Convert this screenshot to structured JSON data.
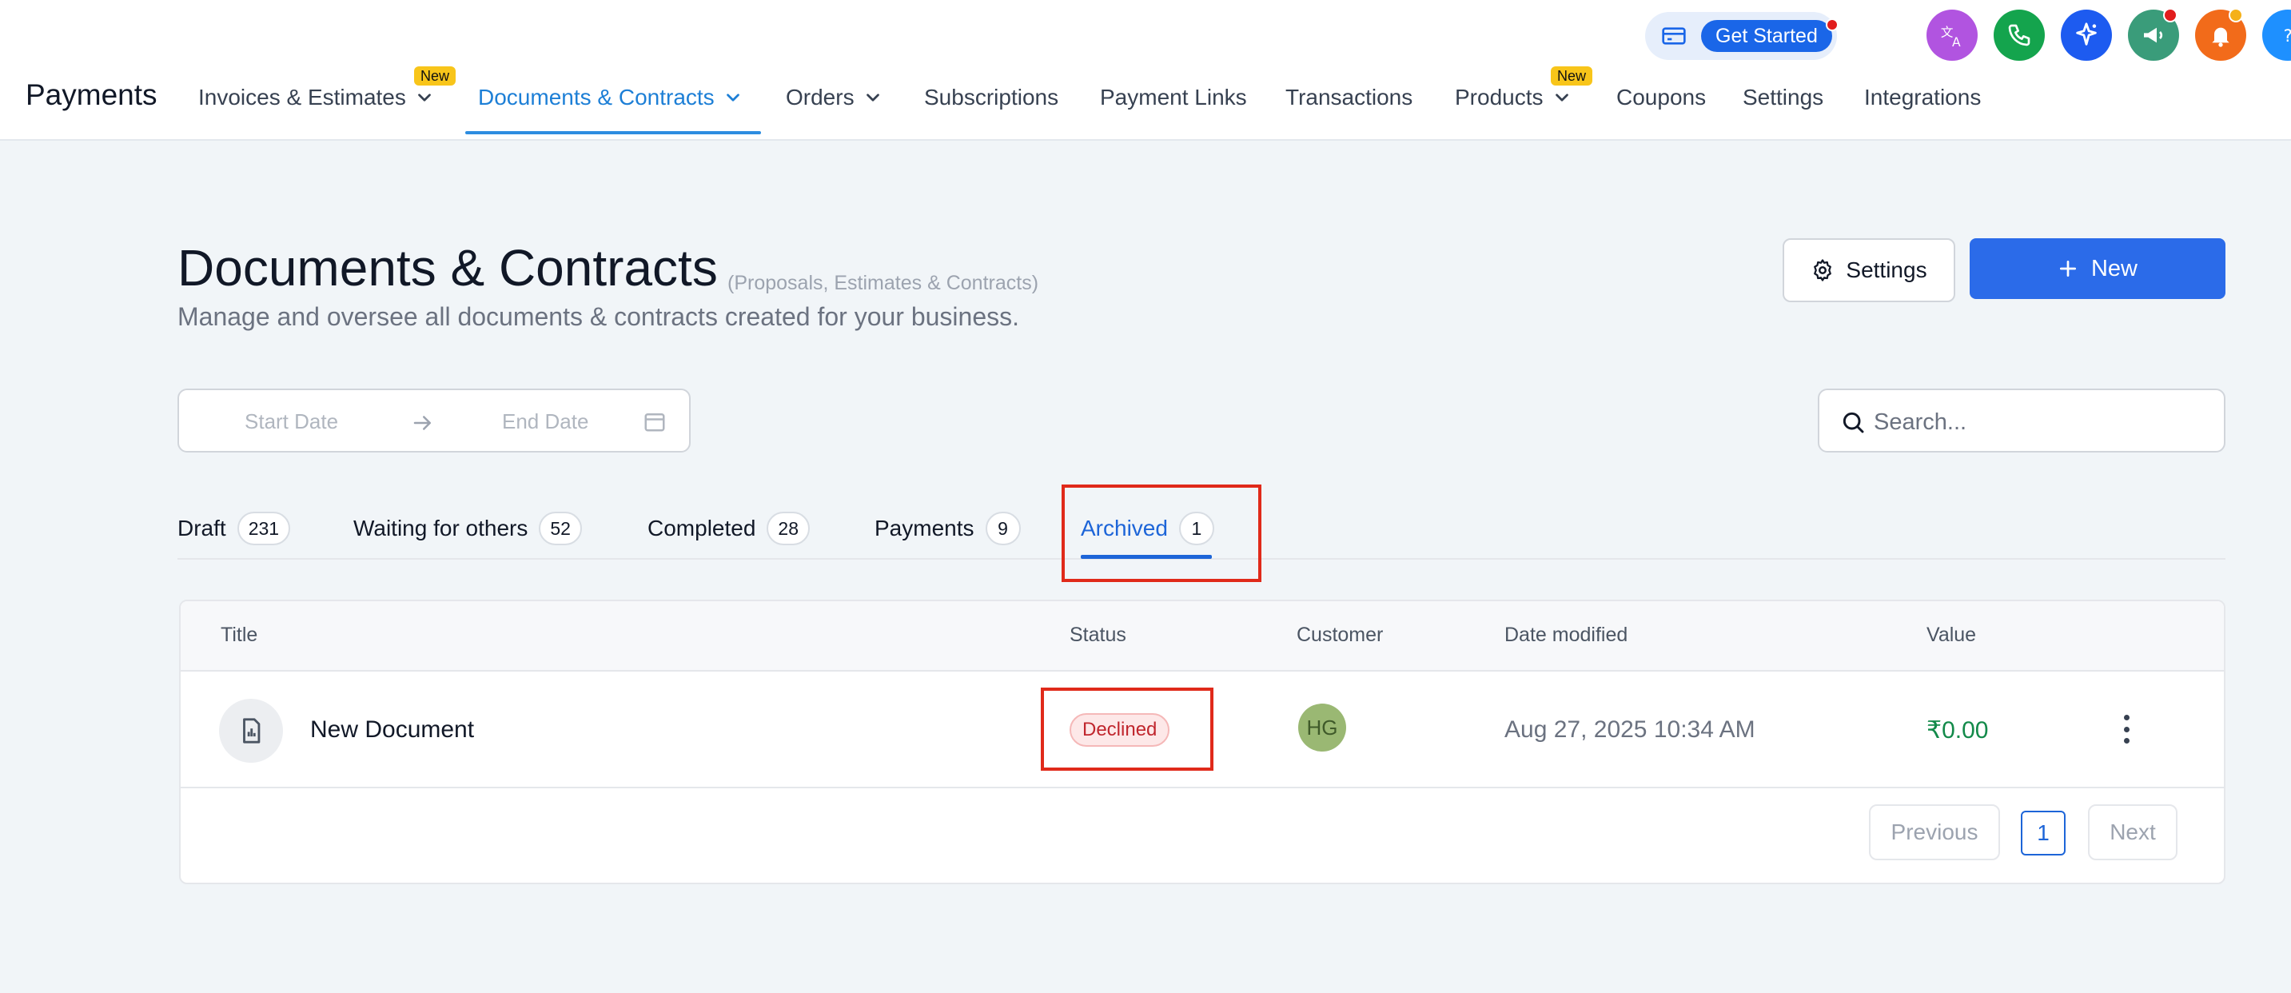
{
  "header": {
    "brand": "Payments",
    "nav": [
      {
        "label": "Invoices & Estimates",
        "badge": "New"
      },
      {
        "label": "Documents & Contracts"
      },
      {
        "label": "Orders"
      },
      {
        "label": "Subscriptions"
      },
      {
        "label": "Payment Links"
      },
      {
        "label": "Transactions"
      },
      {
        "label": "Products",
        "badge": "New"
      },
      {
        "label": "Coupons"
      },
      {
        "label": "Settings"
      },
      {
        "label": "Integrations"
      }
    ],
    "get_started": "Get Started",
    "icons": [
      "translate-icon",
      "phone-icon",
      "ai-sparkle-icon",
      "megaphone-icon",
      "bell-icon",
      "help-icon"
    ],
    "colors": {
      "translate": "#b154e0",
      "phone": "#14a44d",
      "ai": "#1d5bf0",
      "megaphone": "#3a9c7a",
      "bell": "#f26b1a",
      "help": "#1e90ff"
    }
  },
  "page": {
    "title": "Documents & Contracts",
    "subtitle": "(Proposals, Estimates & Contracts)",
    "description": "Manage and oversee all documents & contracts created for your business.",
    "settings_label": "Settings",
    "new_label": "New"
  },
  "filters": {
    "start_date": "Start Date",
    "end_date": "End Date",
    "search_placeholder": "Search..."
  },
  "tabs": [
    {
      "label": "Draft",
      "count": "231"
    },
    {
      "label": "Waiting for others",
      "count": "52"
    },
    {
      "label": "Completed",
      "count": "28"
    },
    {
      "label": "Payments",
      "count": "9"
    },
    {
      "label": "Archived",
      "count": "1",
      "active": true
    }
  ],
  "table": {
    "columns": [
      "Title",
      "Status",
      "Customer",
      "Date modified",
      "Value"
    ],
    "rows": [
      {
        "title": "New Document",
        "status": "Declined",
        "customer": "HG",
        "date_modified": "Aug 27, 2025 10:34 AM",
        "value": "₹0.00"
      }
    ]
  },
  "pagination": {
    "previous": "Previous",
    "page": "1",
    "next": "Next"
  }
}
